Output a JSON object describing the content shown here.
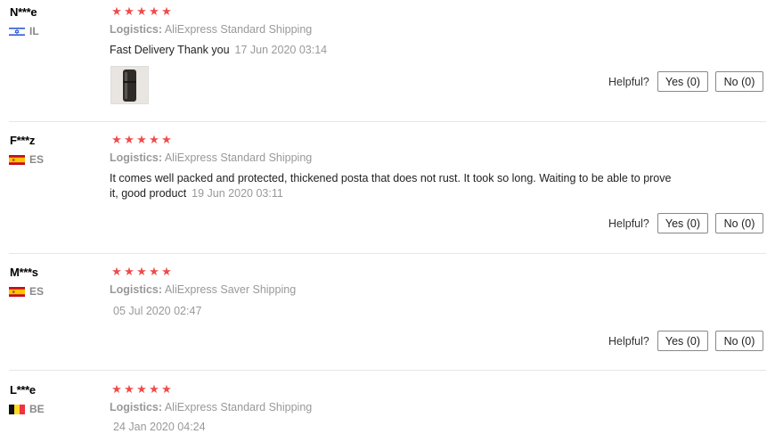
{
  "reviews": [
    {
      "name": "N***e",
      "country": "IL",
      "flag": "il",
      "stars": 5,
      "logistics_label": "Logistics:",
      "logistics_value": "AliExpress Standard Shipping",
      "feedback": "Fast Delivery Thank you",
      "date": "17 Jun 2020 03:14",
      "has_photo": true,
      "helpful_label": "Helpful?",
      "yes_label": "Yes (0)",
      "no_label": "No (0)"
    },
    {
      "name": "F***z",
      "country": "ES",
      "flag": "es",
      "stars": 5,
      "logistics_label": "Logistics:",
      "logistics_value": "AliExpress Standard Shipping",
      "feedback_line1": "It comes well packed and protected, thickened posta that does not rust. It took so long. Waiting to be able to prove",
      "feedback_line2": "it, good product",
      "date": "19 Jun 2020 03:11",
      "helpful_label": "Helpful?",
      "yes_label": "Yes (0)",
      "no_label": "No (0)"
    },
    {
      "name": "M***s",
      "country": "ES",
      "flag": "es",
      "stars": 5,
      "logistics_label": "Logistics:",
      "logistics_value": "AliExpress Saver Shipping",
      "date": "05 Jul 2020 02:47",
      "helpful_label": "Helpful?",
      "yes_label": "Yes (0)",
      "no_label": "No (0)"
    },
    {
      "name": "L***e",
      "country": "BE",
      "flag": "be",
      "stars": 5,
      "logistics_label": "Logistics:",
      "logistics_value": "AliExpress Standard Shipping",
      "date": "24 Jan 2020 04:24"
    }
  ],
  "colors": {
    "star": "#f04b4b",
    "muted": "#999999",
    "divider": "#e6e6e6"
  }
}
